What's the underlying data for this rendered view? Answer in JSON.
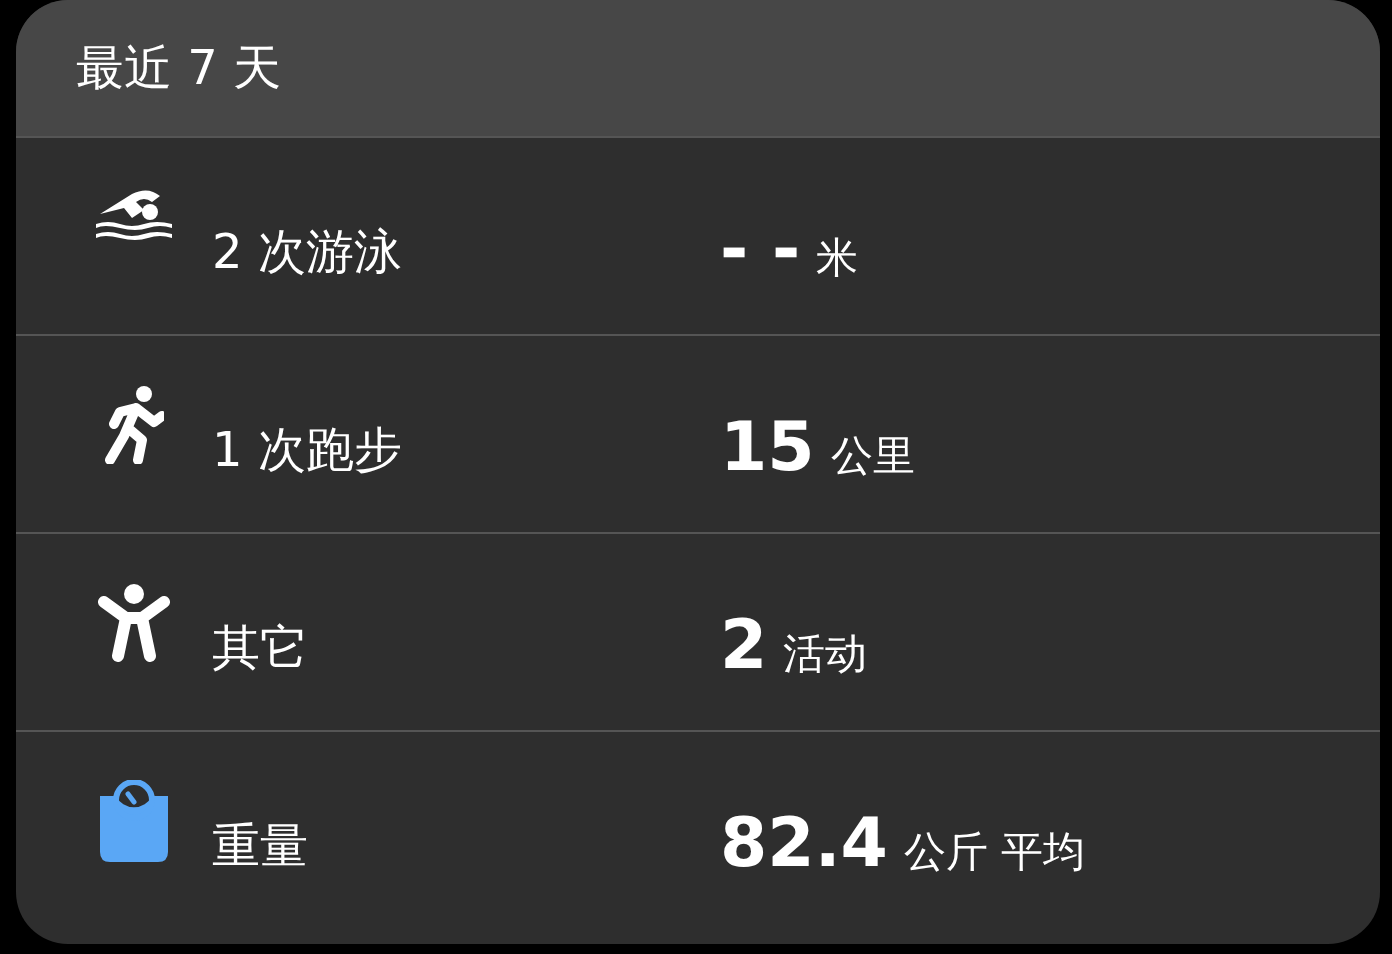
{
  "card": {
    "title": "最近 7 天"
  },
  "rows": [
    {
      "kind": "swim",
      "label": "2 次游泳",
      "number": "- -",
      "unit": "米"
    },
    {
      "kind": "run",
      "label": "1 次跑步",
      "number": "15",
      "unit": "公里"
    },
    {
      "kind": "other",
      "label": "其它",
      "number": "2",
      "unit": "活动"
    },
    {
      "kind": "weight",
      "label": "重量",
      "number": "82.4",
      "unit": "公斤 平均"
    }
  ]
}
